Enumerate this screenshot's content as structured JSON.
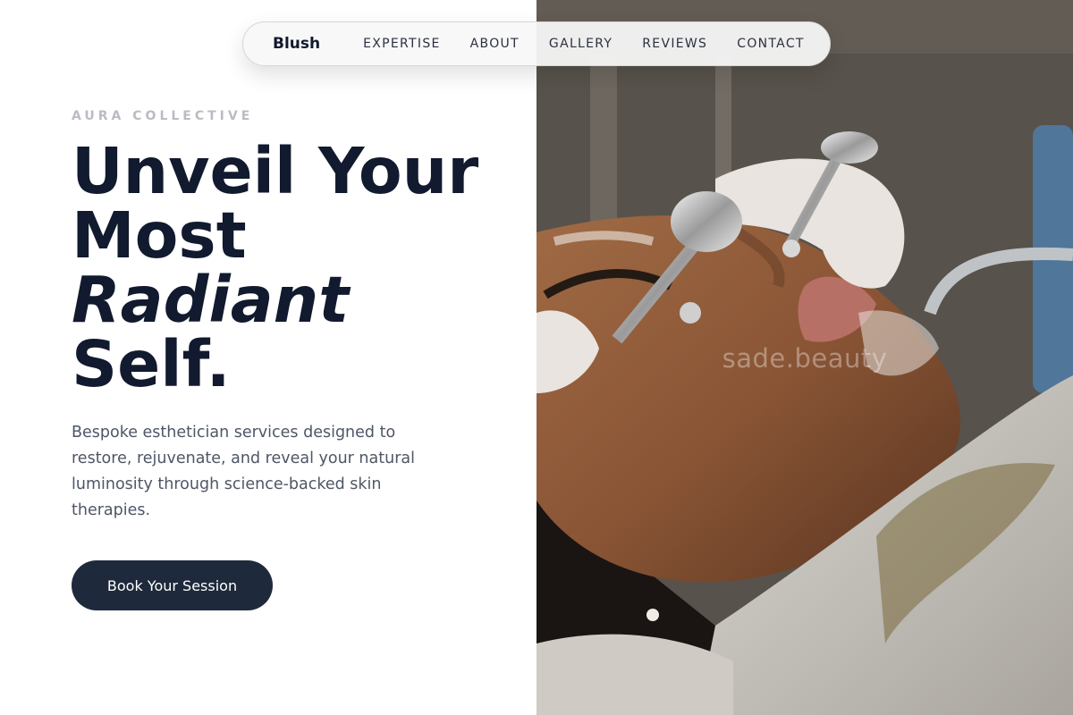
{
  "nav": {
    "brand": "Blush",
    "links": [
      "EXPERTISE",
      "ABOUT",
      "GALLERY",
      "REVIEWS",
      "CONTACT"
    ]
  },
  "hero": {
    "eyebrow": "AURA COLLECTIVE",
    "headline": {
      "line1": "Unveil Your",
      "line2": "Most",
      "line3": "Radiant",
      "line4": "Self."
    },
    "description": "Bespoke esthetician services designed to restore, rejuvenate, and reveal your natural luminosity through science-backed skin therapies.",
    "cta_label": "Book Your Session"
  },
  "photo": {
    "watermark": "sade.beauty"
  },
  "colors": {
    "primary_dark": "#1e293b",
    "headline": "#111a2e",
    "eyebrow": "#b9bcc2",
    "body_text": "#4e5666"
  }
}
